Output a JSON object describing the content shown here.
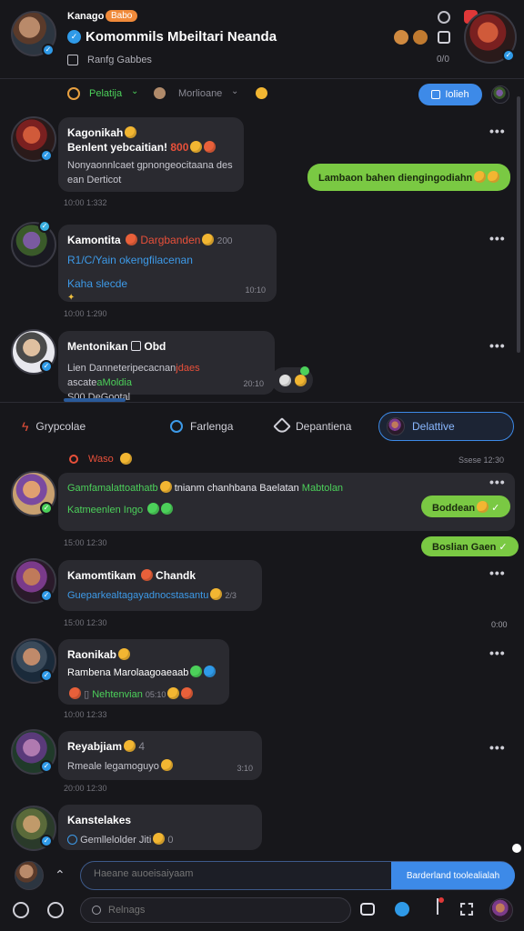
{
  "header": {
    "username": "Kanago",
    "badge": "Babo",
    "channel_title": "Komommils Mbeiltari Neanda",
    "sub_label": "Ranfg Gabbes",
    "counter": "0/0"
  },
  "toolbar": {
    "filter_label": "Pelatija",
    "second_label": "Morlioane",
    "action_button": "Iolieh"
  },
  "messages_top": [
    {
      "name": "Kagonikah",
      "line1": "Benlent yebcaitian!",
      "line1_red": "800",
      "line2": "Nonyaonnlcaet gpnongeocitaana des",
      "line3": "ean Derticot",
      "time": "10:00 1:332"
    },
    {
      "name": "Kamontita",
      "name_red": "Dargbanden",
      "name_tail": "200",
      "line1": "R1/C/Yain okengfilacenan",
      "line2": "Kaha slecde",
      "line2_time": "10:10",
      "time": "10:00 1:290"
    },
    {
      "name": "Mentonikan",
      "name_tail": "Obd",
      "line1": "Lien Danneteripecacnan",
      "line1_red": "jdaes",
      "line1_tail": "ascate",
      "line1_green": "aMoldia",
      "line2": "S00 DeGootal",
      "line2_time": "20:10",
      "time": "10:00 1:230"
    }
  ],
  "outgoing_top": {
    "text": "Lambaon bahen diengingodiahn"
  },
  "tabs": [
    {
      "label": "Grypcolae",
      "icon": "lightning-icon"
    },
    {
      "label": "Farlenga",
      "icon": "search-icon"
    },
    {
      "label": "Depantiena",
      "icon": "tag-icon"
    },
    {
      "label": "Delattive",
      "icon": "avatar-icon"
    }
  ],
  "section_label": "Waso",
  "section_time": "Ssese 12:30",
  "messages_bottom": [
    {
      "name": "Gamfamalattoathatb",
      "name_tail": "tnianm chanhbana Baelatan",
      "name_green": "Mabtolan",
      "line1": "Katmeenlen Ingo",
      "time": "15:00 12:30"
    },
    {
      "name": "Kamomtikam",
      "name_tail": "Chandk",
      "line1": "Gueparkealtagayadnocstasantu",
      "line1_tail": "2/3",
      "time": "15:00 12:30",
      "side_time": "0:00"
    },
    {
      "name": "Raonikab",
      "line1": "Rambena Marolaagoaeaab",
      "line2": "Nehtenvian",
      "line2_tail": "05:10",
      "time": "10:00 12:33"
    },
    {
      "name": "Reyabjiam",
      "name_tail": "4",
      "line1": "Rmeale legamoguyo",
      "line1_time": "3:10",
      "time": "20:00 12:30"
    },
    {
      "name": "Kanstelakes",
      "line1": "Gemllelolder Jiti",
      "line1_tail": "0"
    }
  ],
  "outgoing_bottom": [
    {
      "text": "Boddean"
    },
    {
      "text": "Boslian Gaen"
    }
  ],
  "composer": {
    "placeholder": "Haeane auoeisaiyaam",
    "send_label": "Barderland toolealialah"
  },
  "bottom_bar": {
    "search_placeholder": "Relnags"
  },
  "colors": {
    "background": "#17171b",
    "bubble": "#2a2a30",
    "accent_blue": "#3d8ae8",
    "outgoing_green": "#7ac943",
    "badge_orange": "#f08a3a"
  }
}
